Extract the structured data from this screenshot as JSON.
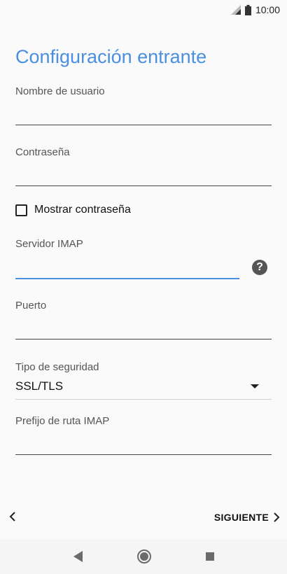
{
  "status_bar": {
    "time": "10:00"
  },
  "page": {
    "title": "Configuración entrante"
  },
  "fields": {
    "username": {
      "label": "Nombre de usuario",
      "value": ""
    },
    "password": {
      "label": "Contraseña",
      "value": ""
    },
    "show_password": {
      "label": "Mostrar contraseña",
      "checked": false
    },
    "imap_server": {
      "label": "Servidor IMAP",
      "value": ""
    },
    "port": {
      "label": "Puerto",
      "value": ""
    },
    "security_type": {
      "label": "Tipo de seguridad",
      "value": "SSL/TLS"
    },
    "imap_path_prefix": {
      "label": "Prefijo de ruta IMAP",
      "value": ""
    }
  },
  "actions": {
    "next_label": "SIGUIENTE"
  },
  "colors": {
    "accent": "#4a8fe0",
    "text": "#111111",
    "label": "#555555"
  }
}
